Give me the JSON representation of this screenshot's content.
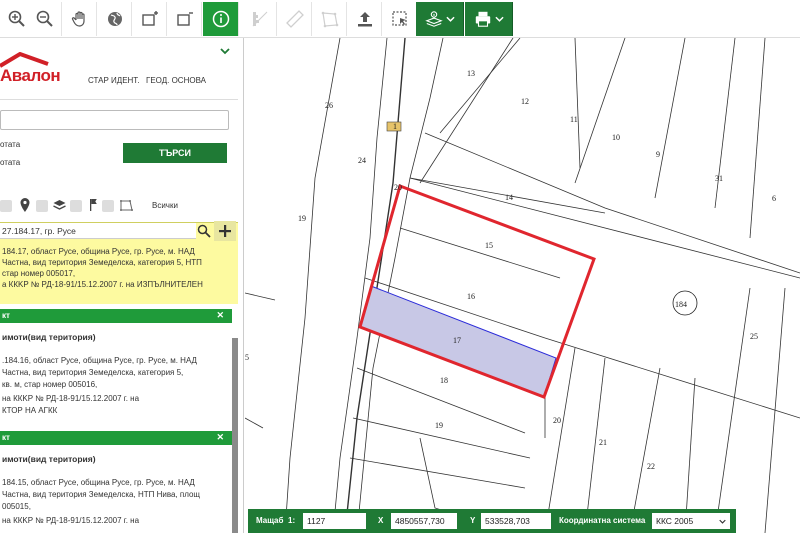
{
  "toolbar": {
    "colors": {
      "active": "#1f9b3a",
      "dark_green": "#1f7a35"
    }
  },
  "sidebar": {
    "logo_text": "Авалон",
    "tabs": [
      "СТАР ИДЕНТ.",
      "ГЕОД. ОСНОВА"
    ],
    "labels": [
      "отата",
      "отата"
    ],
    "search_button": "ТЪРСИ",
    "filter_all": "Всички",
    "selected_search": "27.184.17, гр. Русе",
    "selected_info": [
      "184.17, област Русе, община Русе, гр. Русе, м. НАД",
      "Частна, вид територия Земеделска, категория 5, НТП",
      "стар номер 005017,",
      "а ККKP № РД-18-91/15.12.2007 г. на ИЗПЪЛНИТЕЛЕН"
    ],
    "panels": [
      {
        "header": "кт",
        "title": "имоти(вид територия)",
        "lines": [
          ".184.16, област Русе, община Русе, гр. Русе, м. НАД",
          "Частна, вид територия Земеделска, категория 5,",
          "кв. м, стар номер 005016,",
          "на ККKP № РД-18-91/15.12.2007 г. на",
          "КТОР НА АГКК"
        ]
      },
      {
        "header": "кт",
        "title": "имоти(вид територия)",
        "lines": [
          "184.15, област Русе, община Русе, гр. Русе, м. НАД",
          "Частна, вид територия Земеделска, НТП Нива, площ",
          "005015,",
          "на ККKP № РД-18-91/15.12.2007 г. на"
        ]
      }
    ]
  },
  "map": {
    "parcels": [
      "13",
      "12",
      "11",
      "10",
      "9",
      "31",
      "6",
      "26",
      "24",
      "1",
      "20",
      "14",
      "15",
      "16",
      "17",
      "18",
      "19",
      "19",
      "5",
      "184",
      "25",
      "20",
      "21",
      "22"
    ],
    "selected_color": "#e0262e",
    "highlight_color": "#c8c8e6"
  },
  "statusbar": {
    "scale_label": "Мащаб",
    "scale_prefix": "1:",
    "scale_value": "1127",
    "x_label": "X",
    "x_value": "4850557,730",
    "y_label": "Y",
    "y_value": "533528,703",
    "crs_label": "Координатна система",
    "crs_value": "ККС 2005"
  }
}
